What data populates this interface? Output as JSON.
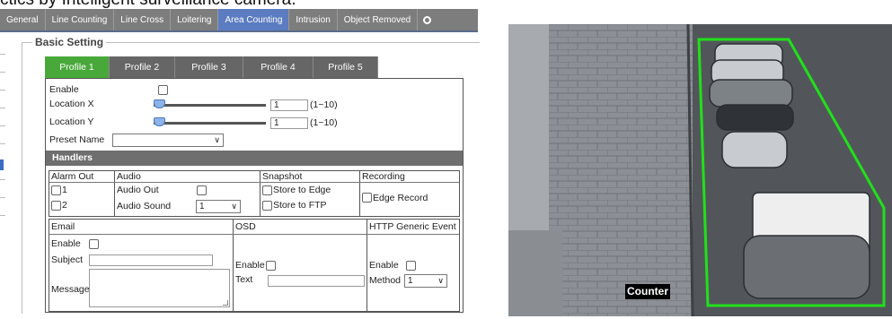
{
  "caption": "ctics by Intelligent surveillance camera.",
  "tabs": [
    "General",
    "Line Counting",
    "Line Cross",
    "Loitering",
    "Area Counting",
    "Intrusion",
    "Object Removed"
  ],
  "active_tab": "Area Counting",
  "more_icon": "circle-more-icon",
  "basic_setting": "Basic Setting",
  "profiles": [
    "Profile 1",
    "Profile 2",
    "Profile 3",
    "Profile 4",
    "Profile 5"
  ],
  "active_profile": "Profile 1",
  "form": {
    "enable_label": "Enable",
    "location_x_label": "Location X",
    "location_x_value": "1",
    "location_x_range": "(1~10)",
    "location_y_label": "Location Y",
    "location_y_value": "1",
    "location_y_range": "(1~10)",
    "preset_name_label": "Preset Name",
    "preset_name_value": ""
  },
  "handlers": {
    "title": "Handlers",
    "alarm_out": "Alarm Out",
    "alarm_1": "1",
    "alarm_2": "2",
    "audio": "Audio",
    "audio_out": "Audio Out",
    "audio_sound": "Audio Sound",
    "audio_sound_value": "1",
    "snapshot": "Snapshot",
    "store_edge": "Store to Edge",
    "store_ftp": "Store to FTP",
    "recording": "Recording",
    "edge_record": "Edge Record"
  },
  "events": {
    "email": "Email",
    "email_enable": "Enable",
    "subject": "Subject",
    "message": "Message",
    "osd": "OSD",
    "osd_enable": "Enable",
    "osd_text": "Text",
    "http": "HTTP Generic Event",
    "http_enable": "Enable",
    "method": "Method",
    "method_value": "1"
  },
  "camera": {
    "overlay_label": "Counter",
    "zone_color": "#21e01a"
  },
  "colors": {
    "tab_active": "#5b7cc0",
    "profile_active": "#48a83a"
  }
}
